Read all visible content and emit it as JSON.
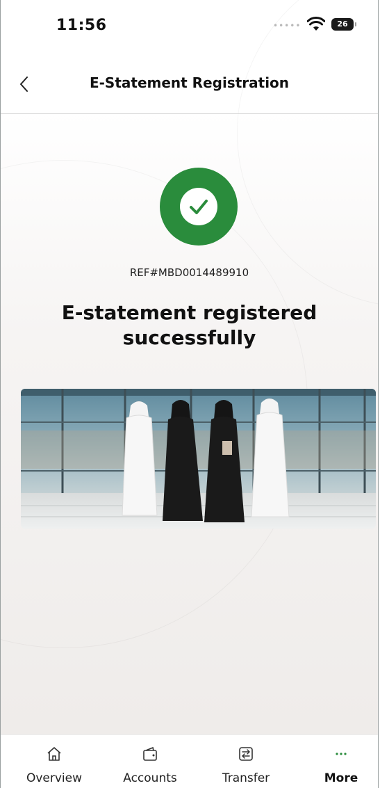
{
  "status_bar": {
    "time": "11:56",
    "signal": "•••••",
    "battery": "26"
  },
  "header": {
    "title": "E-Statement Registration",
    "back_icon": "chevron-left-icon"
  },
  "result": {
    "icon": "check-icon",
    "accent": "#2a8c3c",
    "reference": "REF#MBD0014489910",
    "message_line1": "E-statement registered",
    "message_line2": "successfully"
  },
  "banner": {
    "description_icon": "people-walking-illustration"
  },
  "bottom_nav": {
    "items": [
      {
        "label": "Overview",
        "icon": "home-icon",
        "active": false
      },
      {
        "label": "Accounts",
        "icon": "wallet-icon",
        "active": false
      },
      {
        "label": "Transfer",
        "icon": "transfer-icon",
        "active": false
      },
      {
        "label": "More",
        "icon": "more-dots-icon",
        "active": true
      }
    ]
  }
}
